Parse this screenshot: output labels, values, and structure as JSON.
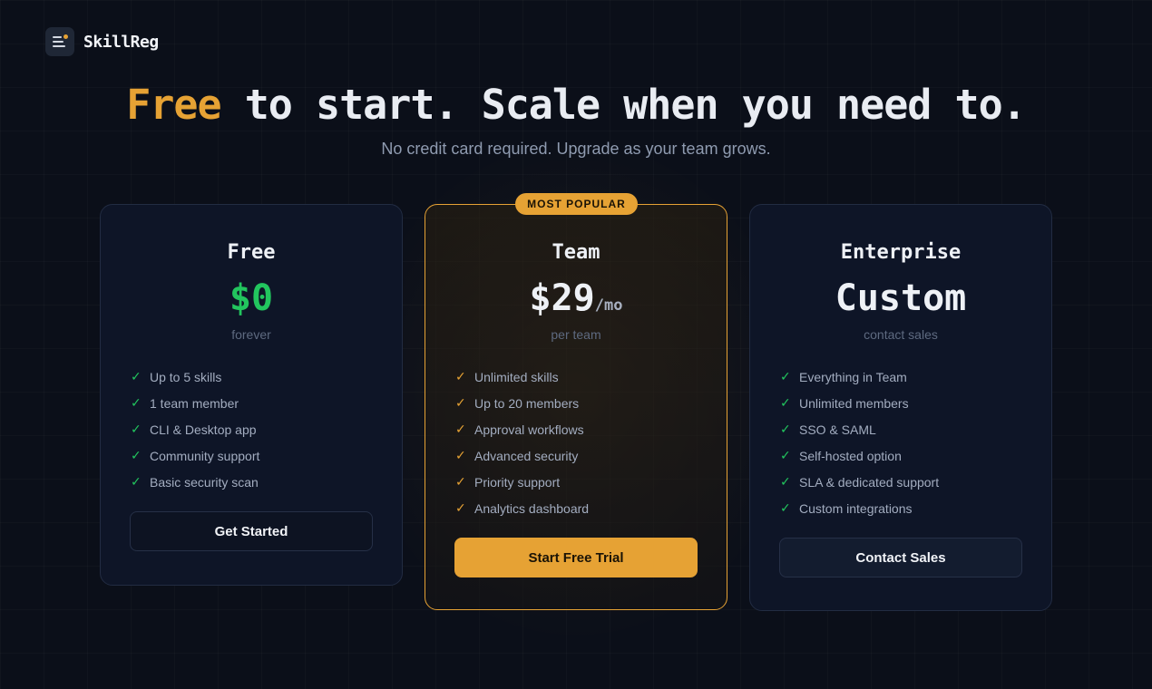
{
  "brand": {
    "name": "SkillReg",
    "logo_icon": "skillreg-logo-icon"
  },
  "hero": {
    "title_accent": "Free",
    "title_rest": " to start. Scale when you need to.",
    "subtitle": "No credit card required. Upgrade as your team grows."
  },
  "colors": {
    "accent": "#e6a234",
    "success": "#22c55e",
    "background": "#0b0f19"
  },
  "plans": [
    {
      "name": "Free",
      "price": "$0",
      "price_unit": "",
      "period": "forever",
      "features": [
        "Up to 5 skills",
        "1 team member",
        "CLI & Desktop app",
        "Community support",
        "Basic security scan"
      ],
      "cta": "Get Started"
    },
    {
      "badge": "MOST POPULAR",
      "name": "Team",
      "price": "$29",
      "price_unit": "/mo",
      "period": "per team",
      "features": [
        "Unlimited skills",
        "Up to 20 members",
        "Approval workflows",
        "Advanced security",
        "Priority support",
        "Analytics dashboard"
      ],
      "cta": "Start Free Trial"
    },
    {
      "name": "Enterprise",
      "price": "Custom",
      "price_unit": "",
      "period": "contact sales",
      "features": [
        "Everything in Team",
        "Unlimited members",
        "SSO & SAML",
        "Self-hosted option",
        "SLA & dedicated support",
        "Custom integrations"
      ],
      "cta": "Contact Sales"
    }
  ],
  "icons": {
    "check": "✓"
  }
}
